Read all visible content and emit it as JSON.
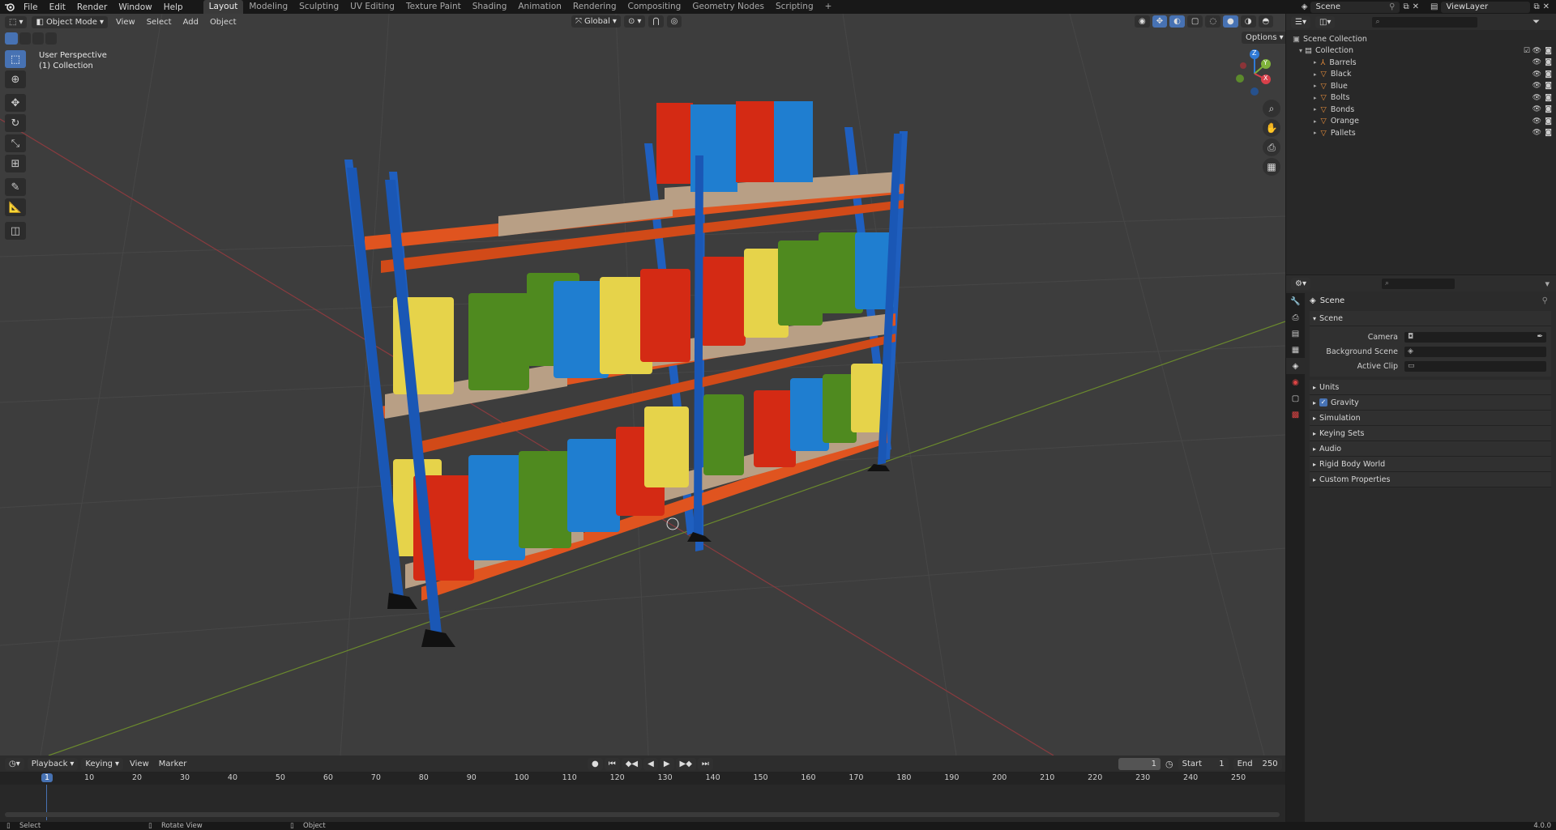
{
  "menus": [
    "File",
    "Edit",
    "Render",
    "Window",
    "Help"
  ],
  "workspaces": [
    "Layout",
    "Modeling",
    "Sculpting",
    "UV Editing",
    "Texture Paint",
    "Shading",
    "Animation",
    "Rendering",
    "Compositing",
    "Geometry Nodes",
    "Scripting"
  ],
  "add_tab": "+",
  "scene_name": "Scene",
  "view_layer": "ViewLayer",
  "viewport": {
    "mode": "Object Mode",
    "menus": [
      "View",
      "Select",
      "Add",
      "Object"
    ],
    "transform": "Global",
    "options": "Options",
    "overlay_title": "User Perspective",
    "overlay_sub": "(1) Collection",
    "gizmo": {
      "z": "Z",
      "y": "Y",
      "x": "X"
    }
  },
  "outliner": {
    "root": "Scene Collection",
    "collection": "Collection",
    "items": [
      "Barrels",
      "Black",
      "Blue",
      "Bolts",
      "Bonds",
      "Orange",
      "Pallets"
    ]
  },
  "properties": {
    "header": "Scene",
    "section": "Scene",
    "fields": [
      {
        "label": "Camera",
        "value": ""
      },
      {
        "label": "Background Scene",
        "value": ""
      },
      {
        "label": "Active Clip",
        "value": ""
      }
    ],
    "panels": [
      "Units",
      "Gravity",
      "Simulation",
      "Keying Sets",
      "Audio",
      "Rigid Body World",
      "Custom Properties"
    ],
    "gravity_checked": true
  },
  "timeline": {
    "menus": [
      "Playback",
      "Keying",
      "View",
      "Marker"
    ],
    "current_frame": "1",
    "start_label": "Start",
    "start": "1",
    "end_label": "End",
    "end": "250",
    "ruler": [
      "1",
      "10",
      "20",
      "30",
      "40",
      "50",
      "60",
      "70",
      "80",
      "90",
      "100",
      "110",
      "120",
      "130",
      "140",
      "150",
      "160",
      "170",
      "180",
      "190",
      "200",
      "210",
      "220",
      "230",
      "240",
      "250"
    ]
  },
  "status": {
    "select": "Select",
    "rotate": "Rotate View",
    "object": "Object",
    "version": "4.0.0"
  },
  "colors": {
    "accent": "#4772b3",
    "orange": "#e0541f",
    "blue": "#1f64c8",
    "red": "#d42a14",
    "yellow": "#e6d34a",
    "green": "#4f8a1f"
  }
}
